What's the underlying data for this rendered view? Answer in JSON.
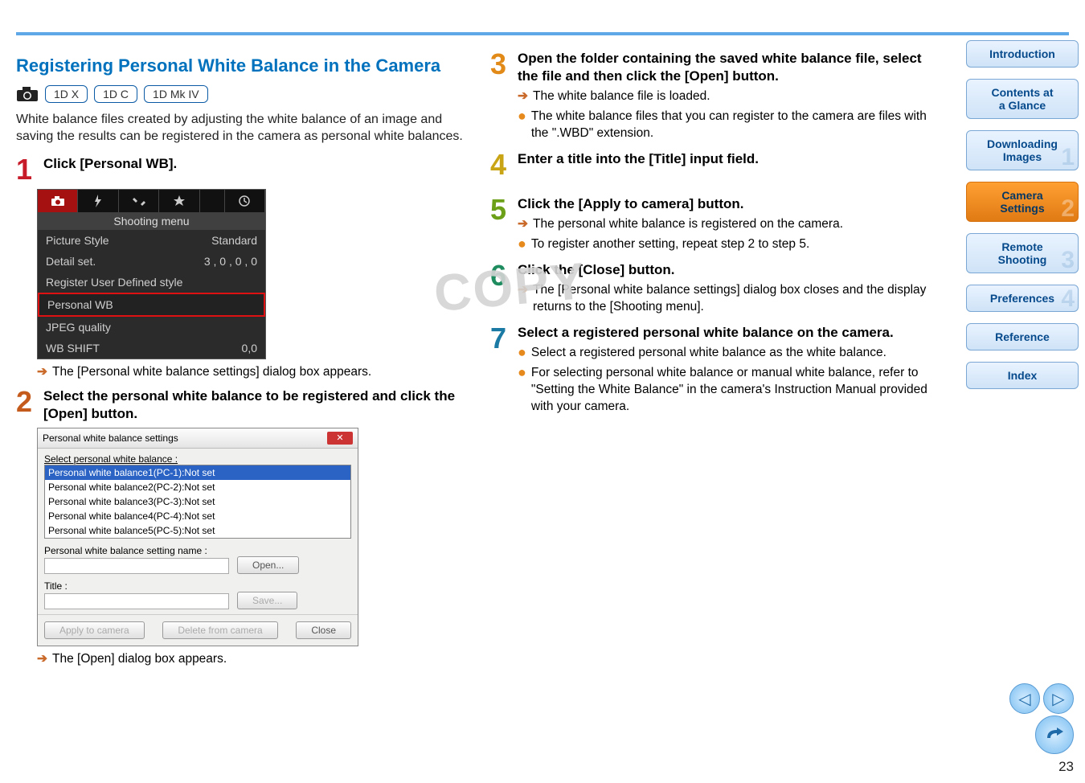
{
  "section_title": "Registering Personal White Balance in the Camera",
  "camera_tags": [
    "1D X",
    "1D C",
    "1D Mk IV"
  ],
  "intro_text": "White balance files created by adjusting the white balance of an image and saving the results can be registered in the camera as personal white balances.",
  "watermark": "COPY",
  "steps_left": {
    "s1": {
      "title": "Click [Personal WB].",
      "sub": "The [Personal white balance settings] dialog box appears."
    },
    "s2": {
      "title": "Select the personal white balance to be registered and click the [Open] button.",
      "sub": "The [Open] dialog box appears."
    }
  },
  "shooting_menu": {
    "header": "Shooting menu",
    "rows": [
      {
        "label": "Picture Style",
        "value": "Standard"
      },
      {
        "label": "Detail set.",
        "value": "3 , 0 , 0 , 0"
      },
      {
        "label": "Register User Defined style",
        "value": ""
      },
      {
        "label": "Personal WB",
        "value": ""
      },
      {
        "label": "JPEG quality",
        "value": ""
      },
      {
        "label": "WB SHIFT",
        "value": "0,0"
      }
    ]
  },
  "dialog": {
    "title": "Personal white balance settings",
    "section_label": "Select personal white balance :",
    "items": [
      "Personal white balance1(PC-1):Not set",
      "Personal white balance2(PC-2):Not set",
      "Personal white balance3(PC-3):Not set",
      "Personal white balance4(PC-4):Not set",
      "Personal white balance5(PC-5):Not set"
    ],
    "name_label": "Personal white balance setting name :",
    "title_label": "Title :",
    "buttons": {
      "open": "Open...",
      "save": "Save...",
      "apply": "Apply to camera",
      "delete": "Delete from camera",
      "close": "Close"
    }
  },
  "steps_right": {
    "s3": {
      "title": "Open the folder containing the saved white balance file, select the file and then click the [Open] button.",
      "sub_a": "The white balance file is loaded.",
      "sub_b": "The white balance files that you can register to the camera are files with the \".WBD\" extension."
    },
    "s4": {
      "title": "Enter a title into the [Title] input field."
    },
    "s5": {
      "title": "Click the [Apply to camera] button.",
      "sub_a": "The personal white balance is registered on the camera.",
      "sub_b": "To register another setting, repeat step 2 to step 5."
    },
    "s6": {
      "title": "Click the [Close] button.",
      "sub_a": "The [Personal white balance settings] dialog box closes and the display returns to the [Shooting menu]."
    },
    "s7": {
      "title": "Select a registered personal white balance on the camera.",
      "sub_a": "Select a registered personal white balance as the white balance.",
      "sub_b": "For selecting personal white balance or manual white balance, refer to \"Setting the White Balance\" in the camera's Instruction Manual provided with your camera."
    }
  },
  "nav": {
    "intro": "Introduction",
    "contents_l1": "Contents at",
    "contents_l2": "a Glance",
    "download_l1": "Downloading",
    "download_l2": "Images",
    "camera_l1": "Camera",
    "camera_l2": "Settings",
    "remote_l1": "Remote",
    "remote_l2": "Shooting",
    "prefs": "Preferences",
    "reference": "Reference",
    "index": "Index"
  },
  "page_number": "23",
  "chart_data": null
}
